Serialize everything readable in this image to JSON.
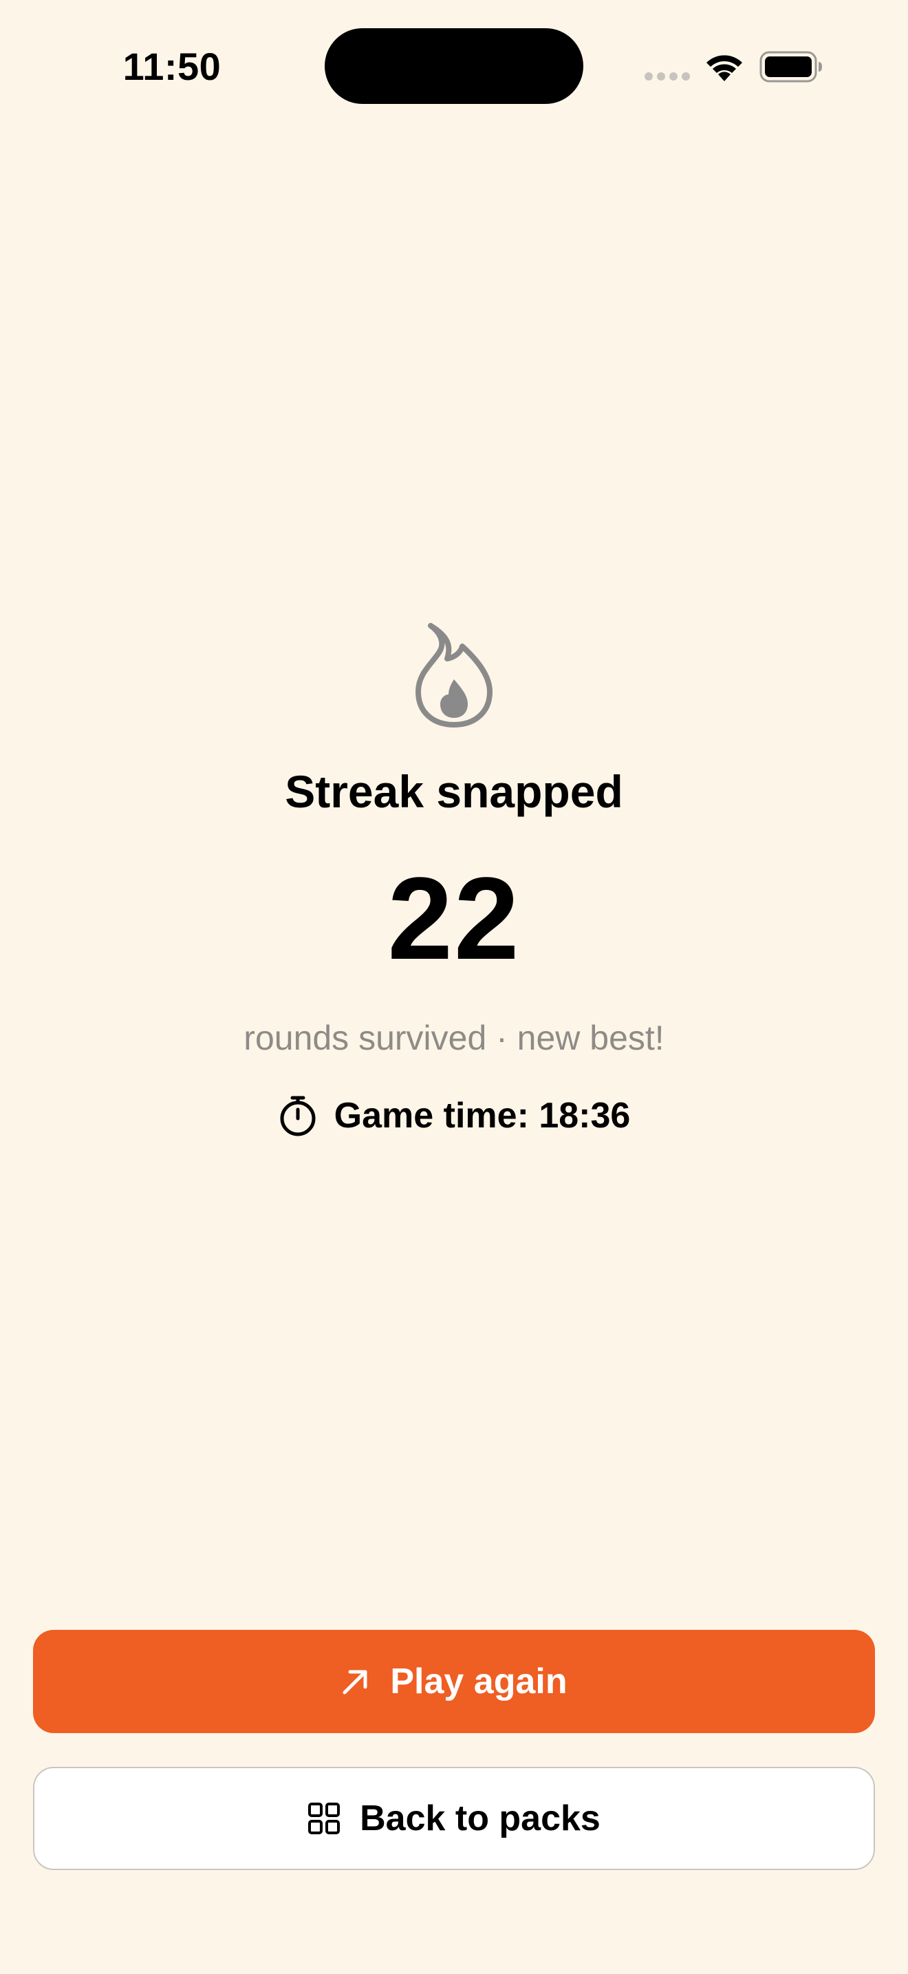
{
  "status_bar": {
    "time": "11:50"
  },
  "result": {
    "title": "Streak snapped",
    "streak_value": "22",
    "subtitle": "rounds survived · new best!",
    "game_time_label": "Game time: 18:36"
  },
  "actions": {
    "play_again_label": "Play again",
    "back_label": "Back to packs"
  },
  "colors": {
    "background": "#FDF5E8",
    "accent": "#EF5E22",
    "muted_text": "#8E8B86",
    "icon_gray": "#8A8A8A"
  },
  "icons": {
    "status": [
      "cellular-signal-icon",
      "wifi-icon",
      "battery-icon"
    ],
    "result": "flame-icon",
    "game_time": "stopwatch-icon",
    "play_again": "arrow-up-right-icon",
    "back": "grid-icon"
  }
}
